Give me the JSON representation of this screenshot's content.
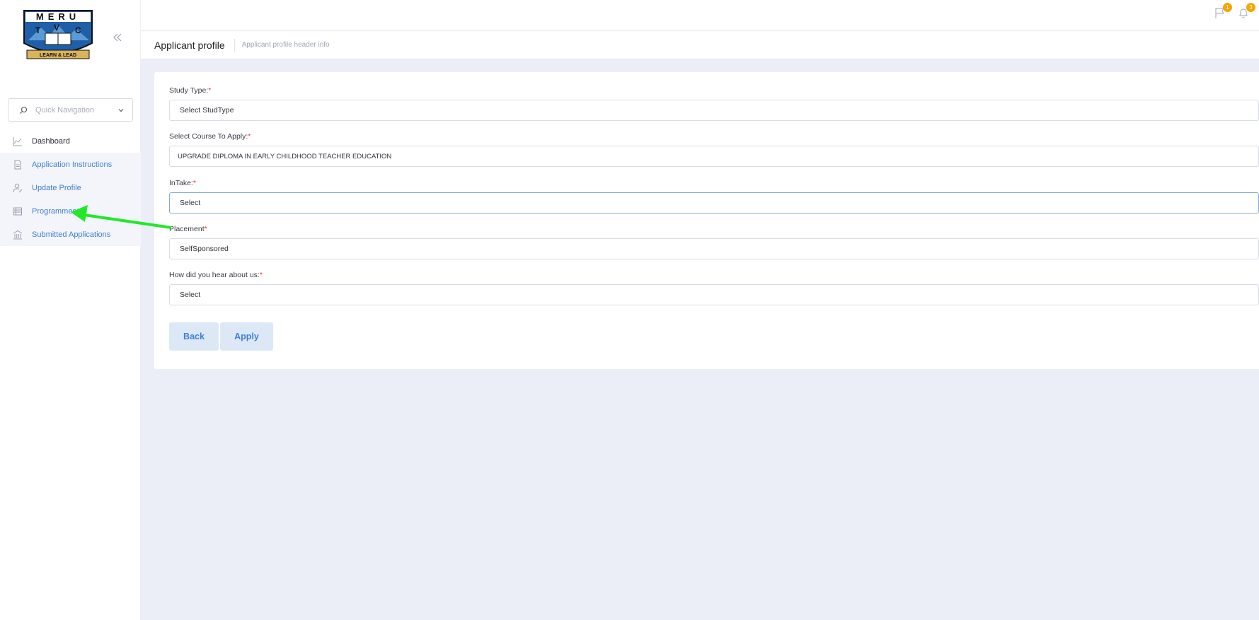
{
  "logo": {
    "top_text": "MERU",
    "letters": [
      "T",
      "V",
      "C"
    ],
    "tagline": "LEARN & LEAD"
  },
  "sidebar": {
    "quick_nav_placeholder": "Quick Navigation",
    "items": [
      {
        "label": "Dashboard",
        "icon": "chart-icon"
      },
      {
        "label": "Application Instructions",
        "icon": "document-icon"
      },
      {
        "label": "Update Profile",
        "icon": "user-edit-icon"
      },
      {
        "label": "Programmes",
        "icon": "list-icon"
      },
      {
        "label": "Submitted Applications",
        "icon": "building-icon"
      }
    ]
  },
  "topbar": {
    "flag_badge": "1",
    "bell_badge": "3"
  },
  "header": {
    "title": "Applicant profile",
    "subtitle": "Applicant profile header info"
  },
  "form": {
    "study_type": {
      "label": "Study Type:",
      "required": "*",
      "value": "Select StudType"
    },
    "course": {
      "label": "Select Course To Apply:",
      "required": "*",
      "value": "UPGRADE DIPLOMA IN EARLY CHILDHOOD TEACHER EDUCATION"
    },
    "intake": {
      "label": "InTake:",
      "required": "*",
      "value": "Select"
    },
    "placement": {
      "label": "Placement",
      "required": "*",
      "value": "SelfSponsored"
    },
    "heard": {
      "label": "How did you hear about us:",
      "required": "*",
      "value": "Select"
    },
    "back_label": "Back",
    "apply_label": "Apply"
  },
  "colors": {
    "accent": "#3f7fd6",
    "required": "#e53935",
    "badge": "#f5a700",
    "annotation_arrow": "#22e82a"
  }
}
